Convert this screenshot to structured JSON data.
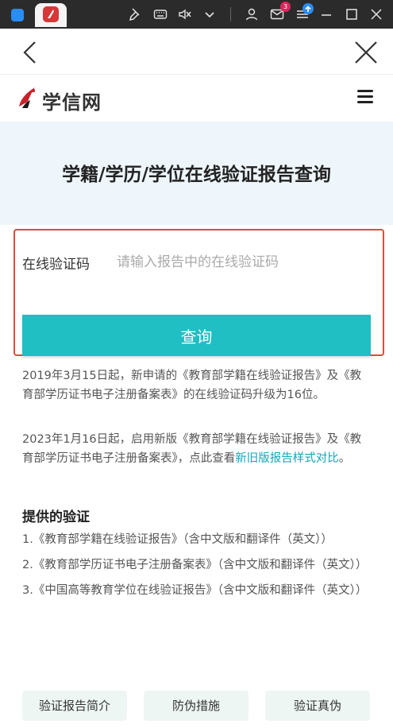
{
  "system_bar": {
    "mail_badge": "3",
    "icons": [
      "app-switcher-icon",
      "app-icon",
      "pin-icon",
      "keyboard-icon",
      "mute-icon",
      "chevron-down-icon",
      "user-icon",
      "mail-icon",
      "list-icon",
      "minimize-icon",
      "maximize-icon",
      "close-icon"
    ]
  },
  "browser_nav": {
    "back_icon": "back-arrow-icon",
    "close_icon": "close-x-icon"
  },
  "site": {
    "logo_text": "学信网",
    "menu_icon": "hamburger-menu-icon"
  },
  "hero": {
    "title": "学籍/学历/学位在线验证报告查询"
  },
  "form": {
    "label": "在线验证码",
    "placeholder": "请输入报告中的在线验证码",
    "value": "",
    "submit_label": "查询"
  },
  "notices": {
    "first": "2019年3月15日起，新申请的《教育部学籍在线验证报告》及《教育部学历证书电子注册备案表》的在线验证码升级为16位。",
    "second_prefix": "2023年1月16日起，启用新版《教育部学籍在线验证报告》及《教育部学历证书电子注册备案表》，点此查看",
    "second_link": "新旧版报告样式对比",
    "second_suffix": "。"
  },
  "provided": {
    "title": "提供的验证",
    "items": [
      "1.《教育部学籍在线验证报告》（含中文版和翻译件（英文））",
      "2.《教育部学历证书电子注册备案表》（含中文版和翻译件（英文））",
      "3.《中国高等教育学位在线验证报告》（含中文版和翻译件（英文））"
    ]
  },
  "bottom_buttons": {
    "intro": "验证报告简介",
    "anti_fake": "防伪措施",
    "verify": "验证真伪"
  },
  "colors": {
    "accent": "#1fbfc3",
    "highlight_border": "#e04a3c",
    "hero_bg": "#eef6fb",
    "link": "#12a6b8"
  }
}
